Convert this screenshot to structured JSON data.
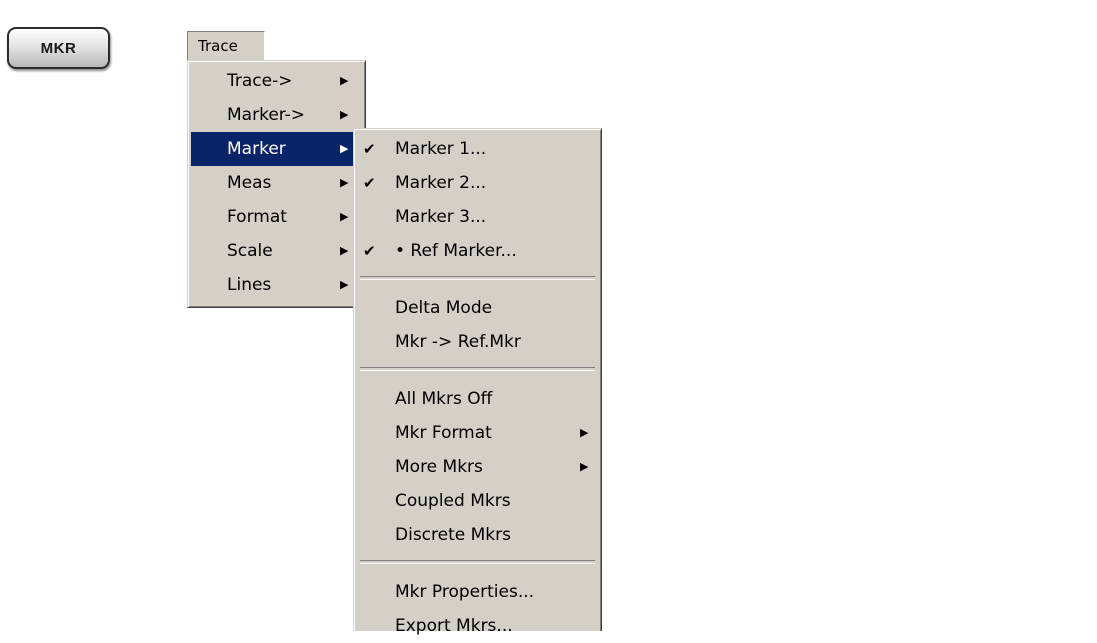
{
  "hardkey": {
    "label": "MKR"
  },
  "menubar": {
    "trace_label": "Trace"
  },
  "trace_menu": {
    "items": [
      {
        "label": "Trace->",
        "arrow": "▶"
      },
      {
        "label": "Marker->",
        "arrow": "▶"
      },
      {
        "label": "Marker",
        "arrow": "▶",
        "selected": true
      },
      {
        "label": "Meas",
        "arrow": "▶"
      },
      {
        "label": "Format",
        "arrow": "▶"
      },
      {
        "label": "Scale",
        "arrow": "▶"
      },
      {
        "label": "Lines",
        "arrow": "▶"
      }
    ]
  },
  "marker_menu": {
    "group1": [
      {
        "label": "Marker 1...",
        "check": "✔"
      },
      {
        "label": "Marker 2...",
        "check": "✔"
      },
      {
        "label": "Marker 3...",
        "check": ""
      },
      {
        "label": "• Ref Marker...",
        "check": "✔"
      }
    ],
    "group2": [
      {
        "label": "Delta Mode"
      },
      {
        "label": "Mkr -> Ref.Mkr"
      }
    ],
    "group3": [
      {
        "label": "All Mkrs Off"
      },
      {
        "label": "Mkr Format",
        "arrow": "▶"
      },
      {
        "label": "More Mkrs",
        "arrow": "▶"
      },
      {
        "label": "Coupled Mkrs"
      },
      {
        "label": "Discrete Mkrs"
      }
    ],
    "group4": [
      {
        "label": "Mkr Properties..."
      },
      {
        "label": "Export Mkrs..."
      }
    ]
  }
}
